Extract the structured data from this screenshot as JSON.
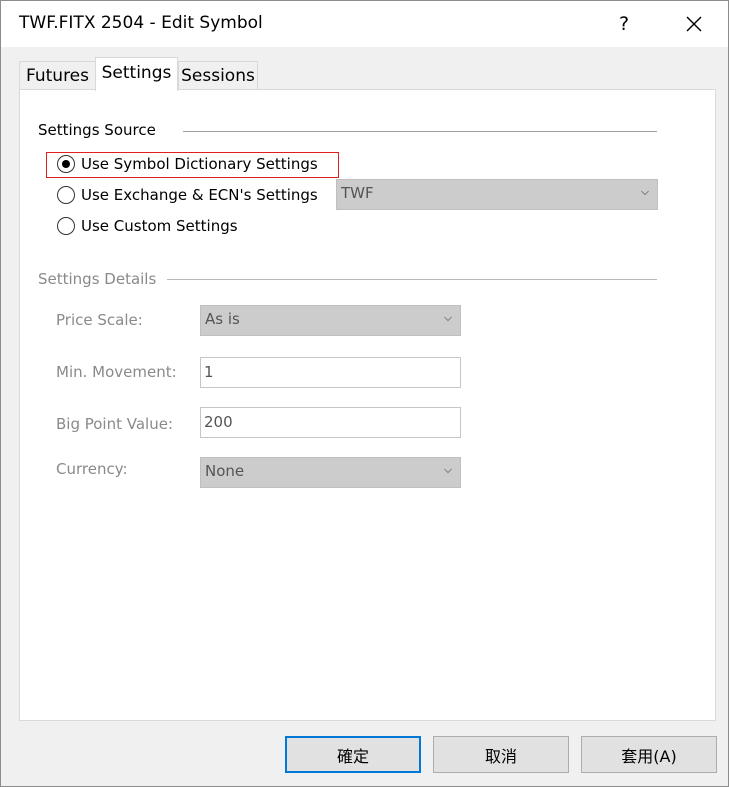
{
  "window": {
    "title": "TWF.FITX 2504 - Edit Symbol",
    "help_glyph": "?",
    "close_glyph": "✕"
  },
  "tabs": [
    {
      "label": "Futures",
      "active": false
    },
    {
      "label": "Settings",
      "active": true
    },
    {
      "label": "Sessions",
      "active": false
    }
  ],
  "settings_source": {
    "heading": "Settings Source",
    "options": [
      {
        "label": "Use Symbol Dictionary Settings",
        "selected": true
      },
      {
        "label": "Use Exchange & ECN's Settings",
        "selected": false
      },
      {
        "label": "Use Custom Settings",
        "selected": false
      }
    ],
    "exchange_select": {
      "value": "TWF",
      "enabled": false
    },
    "highlight_color": "#e02020"
  },
  "settings_details": {
    "heading": "Settings Details",
    "price_scale": {
      "label": "Price Scale:",
      "value": "As is"
    },
    "min_movement": {
      "label": "Min. Movement:",
      "value": "1"
    },
    "big_point_value": {
      "label": "Big Point Value:",
      "value": "200"
    },
    "currency": {
      "label": "Currency:",
      "value": "None"
    }
  },
  "buttons": {
    "ok": "確定",
    "cancel": "取消",
    "apply": "套用(A)"
  },
  "colors": {
    "accent": "#0078d7",
    "disabled_text": "#8a8a8a",
    "disabled_field": "#cccccc"
  }
}
